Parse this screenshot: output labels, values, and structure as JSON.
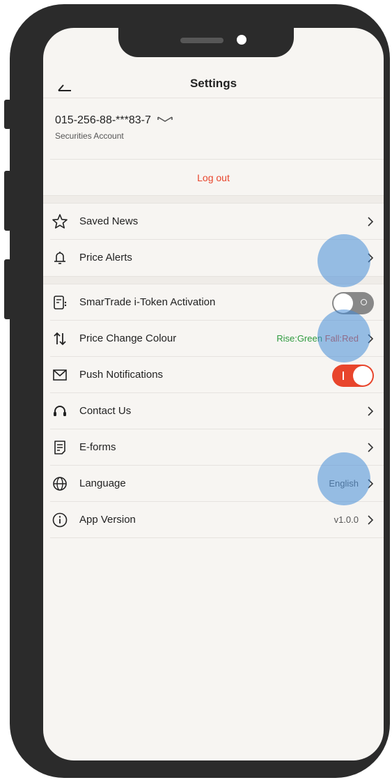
{
  "header": {
    "title": "Settings",
    "back_icon": "back-arrow-icon"
  },
  "account": {
    "number": "015-256-88-***83-7",
    "type": "Securities Account",
    "toggle_icon": "chevron-down-icon"
  },
  "logout_label": "Log out",
  "menu_group1": [
    {
      "label": "Saved News",
      "icon": "star-icon"
    },
    {
      "label": "Price Alerts",
      "icon": "bell-icon"
    }
  ],
  "menu_group2": [
    {
      "label": "SmarTrade i-Token Activation",
      "icon": "token-device-icon",
      "toggle": "off"
    },
    {
      "label": "Price Change Colour",
      "icon": "sort-arrows-icon",
      "rise": "Rise:Green",
      "fall": "Fall:Red"
    },
    {
      "label": "Push Notifications",
      "icon": "mail-icon",
      "toggle": "on"
    },
    {
      "label": "Contact Us",
      "icon": "headset-icon"
    },
    {
      "label": "E-forms",
      "icon": "form-icon"
    },
    {
      "label": "Language",
      "icon": "globe-icon",
      "value": "English"
    },
    {
      "label": "App Version",
      "icon": "info-icon",
      "value": "v1.0.0"
    }
  ],
  "colors": {
    "accent": "#e8452c",
    "rise": "#2e9a3e",
    "fall": "#e8452c",
    "toggle_off": "#888888",
    "touch": "#468cd7"
  }
}
